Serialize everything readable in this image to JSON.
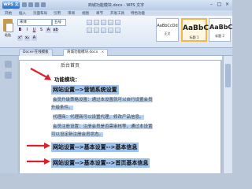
{
  "window": {
    "app_button": "WPS 文字",
    "title": "商城功能模块.docx - WPS 文字"
  },
  "menu": [
    "开始",
    "插入",
    "页面布局",
    "引用",
    "审阅",
    "视图",
    "章节",
    "开发工具",
    "特色功能"
  ],
  "ribbon": {
    "paste_label": "粘贴",
    "font_name": "宋体",
    "font_size": "五号",
    "styles": [
      {
        "sample": "AaBbCcDd",
        "name": "正文"
      },
      {
        "sample": "AaBbCc",
        "name": "标题 1"
      },
      {
        "sample": "AaBbC",
        "name": "标题 2"
      }
    ]
  },
  "doc_tabs": [
    {
      "label": "Docer-在线模板"
    },
    {
      "label": "商城功能模块.docx"
    }
  ],
  "document": {
    "header_text": "后台首页",
    "section_title": "功能模块：",
    "heading1": "网站设置-->营销系统设置",
    "para1": "会员升级策略设置：通过本设置就可以自行设置会员",
    "para1b": "升级条件。",
    "para2": "代理商：代理商可以设置代理，修改产品信息。",
    "para3": "会员注册设置：注册会员是否需审核等，通过本设置",
    "para3b": "可以设定新注册会员状态。",
    "heading2": "网站设置-->基本设置-->基本信息",
    "heading3": "网站设置-->基本设置-->首页基本信息"
  },
  "colors": {
    "highlight": "#9ec2ec",
    "arrow": "#d9232a",
    "selected_style_border": "#f0b84c"
  }
}
